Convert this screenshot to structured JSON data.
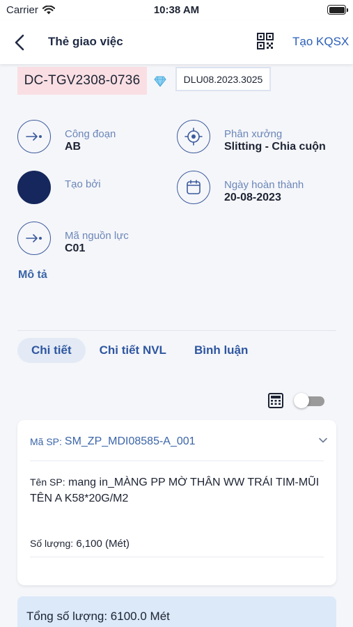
{
  "status_bar": {
    "carrier": "Carrier",
    "time": "10:38 AM"
  },
  "header": {
    "title": "Thẻ giao việc",
    "action_label": "Tạo KQSX",
    "icons": [
      "chevron-left-icon",
      "qr-code-icon"
    ]
  },
  "task": {
    "code": "DC-TGV2308-0736",
    "lot": "DLU08.2023.3025"
  },
  "info": {
    "stage_label": "Công đoạn",
    "stage_value": "AB",
    "workshop_label": "Phân xưởng",
    "workshop_value": "Slitting - Chia cuộn",
    "created_by_label": "Tạo bởi",
    "created_by_value": "",
    "completion_label": "Ngày hoàn thành",
    "completion_value": "20-08-2023",
    "resource_label": "Mã nguồn lực",
    "resource_value": "C01"
  },
  "description_label": "Mô tả",
  "tabs": [
    {
      "label": "Chi tiết",
      "active": true
    },
    {
      "label": "Chi tiết NVL",
      "active": false
    },
    {
      "label": "Bình luận",
      "active": false
    }
  ],
  "toggle": {
    "on": false
  },
  "product": {
    "code_label": "Mã SP:",
    "code_value": "SM_ZP_MDI08585-A_001",
    "name_label": "Tên SP:",
    "name_value": "mang in_MÀNG PP MỜ THÂN WW TRÁI TIM-MŨI TÊN A K58*20G/M2",
    "qty_label": "Số lượng:",
    "qty_value": "6,100",
    "qty_unit": "(Mét)"
  },
  "total": {
    "text": "Tổng số lượng: 6100.0 Mét"
  },
  "colors": {
    "accent": "#2c5fb8",
    "badge_pink": "#f9dfe3",
    "avatar_navy": "#15275c",
    "total_bg": "#dbe9f8"
  }
}
